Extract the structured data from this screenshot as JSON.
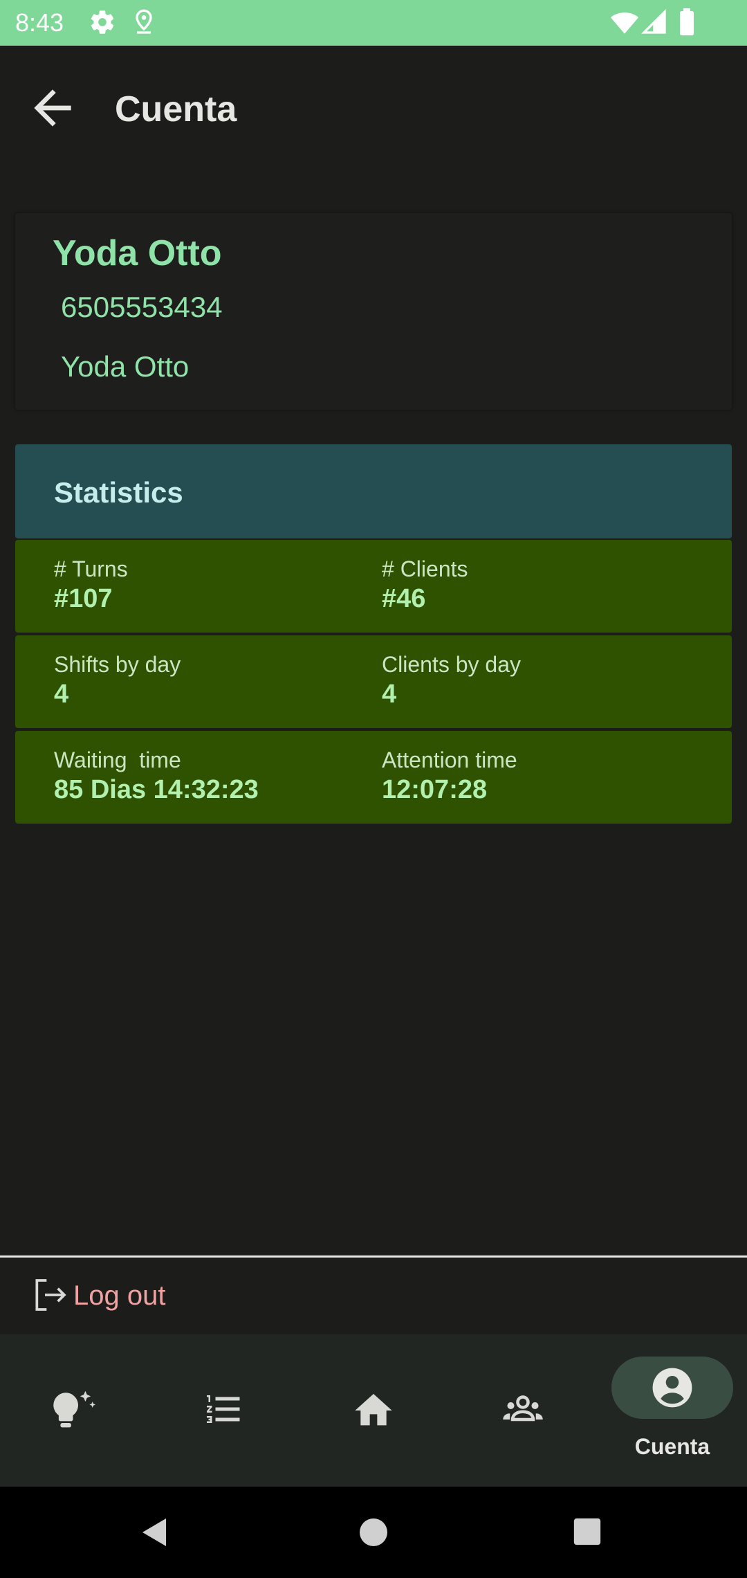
{
  "status_bar": {
    "time": "8:43",
    "icons_left": [
      "gear-icon",
      "location-pin-icon"
    ],
    "icons_right": [
      "wifi-icon",
      "signal-icon",
      "battery-icon"
    ],
    "background": "#7fd897"
  },
  "app_bar": {
    "title": "Cuenta",
    "back_icon": "arrow-left-icon"
  },
  "profile": {
    "name": "Yoda Otto",
    "phone": "6505553434",
    "display_name": "Yoda Otto"
  },
  "statistics": {
    "title": "Statistics",
    "rows": [
      {
        "left": {
          "label": "# Turns",
          "value": "#107"
        },
        "right": {
          "label": "# Clients",
          "value": "#46"
        }
      },
      {
        "left": {
          "label": "Shifts by day",
          "value": "4"
        },
        "right": {
          "label": "Clients by day",
          "value": "4"
        }
      },
      {
        "left": {
          "label": "Waiting  time",
          "value": "85 Dias 14:32:23"
        },
        "right": {
          "label": "Attention time",
          "value": "12:07:28"
        }
      }
    ]
  },
  "logout": {
    "label": "Log out",
    "icon": "logout-icon"
  },
  "bottom_nav": {
    "items": [
      {
        "icon": "lightbulb-sparkle-icon",
        "label": "",
        "active": false
      },
      {
        "icon": "numbered-list-icon",
        "label": "",
        "active": false
      },
      {
        "icon": "home-icon",
        "label": "",
        "active": false
      },
      {
        "icon": "group-icon",
        "label": "",
        "active": false
      },
      {
        "icon": "account-circle-icon",
        "label": "Cuenta",
        "active": true
      }
    ]
  },
  "system_nav": {
    "buttons": [
      "back-triangle-icon",
      "home-circle-icon",
      "recents-square-icon"
    ]
  },
  "colors": {
    "background": "#1c1c1a",
    "accent_green": "#8fe3a8",
    "stats_header": "#254e52",
    "stats_row": "#2e5200",
    "logout_text": "#f0a2a2",
    "nav_bg": "#212623",
    "nav_active_pill": "#3a4d43"
  }
}
